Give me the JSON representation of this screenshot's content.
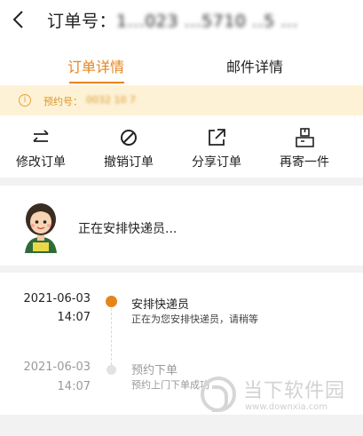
{
  "header": {
    "title_prefix": "订单号：",
    "order_number": "1...023  ...5710  ..5  ..."
  },
  "tabs": [
    {
      "label": "订单详情",
      "active": true
    },
    {
      "label": "邮件详情",
      "active": false
    }
  ],
  "notice": {
    "icon": "info-icon",
    "label": "预约号：",
    "value": "0032   10  7"
  },
  "actions": [
    {
      "label": "修改订单",
      "icon": "swap-arrows-icon"
    },
    {
      "label": "撤销订单",
      "icon": "cancel-circle-icon"
    },
    {
      "label": "分享订单",
      "icon": "share-icon"
    },
    {
      "label": "再寄一件",
      "icon": "package-icon"
    }
  ],
  "courier": {
    "status": "正在安排快递员..."
  },
  "timeline": [
    {
      "date": "2021-06-03",
      "time": "14:07",
      "title": "安排快递员",
      "desc": "正在为您安排快递员，请稍等",
      "active": true
    },
    {
      "date": "2021-06-03",
      "time": "14:07",
      "title": "预约下单",
      "desc": "预约上门下单成功",
      "active": false
    }
  ],
  "watermark": {
    "name": "当下软件园",
    "url": "www.downxia.com"
  },
  "colors": {
    "accent": "#e6841b",
    "notice_bg": "#fdf2d6",
    "muted": "#9a9a9a"
  }
}
